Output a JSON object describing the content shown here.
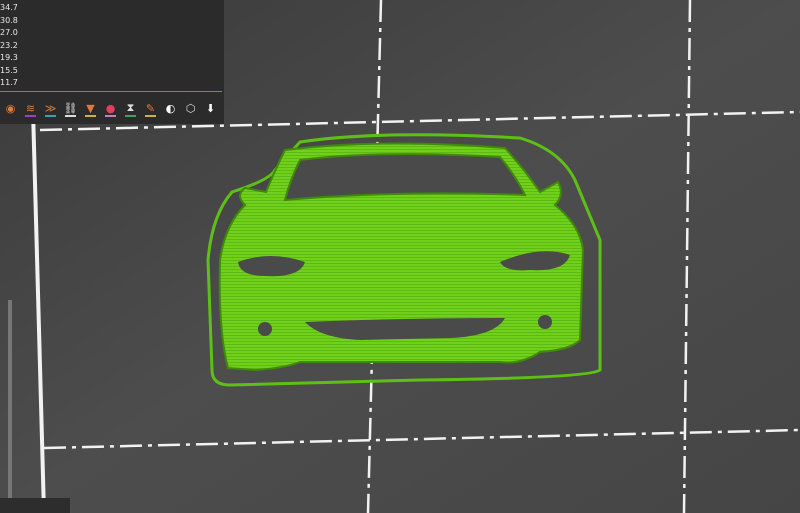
{
  "legend": {
    "values": [
      "34.7",
      "30.8",
      "27.0",
      "23.2",
      "19.3",
      "15.5",
      "11.7"
    ]
  },
  "toolbar": {
    "items": [
      {
        "name": "object-icon",
        "glyph": "◉",
        "color": "#e07a3a",
        "bar": ""
      },
      {
        "name": "layers-icon",
        "glyph": "≋",
        "color": "#d0813f",
        "bar": "#a040c0"
      },
      {
        "name": "infill-chevrons-icon",
        "glyph": "≫",
        "color": "#d0813f",
        "bar": "#3aa0b0"
      },
      {
        "name": "pattern-icon",
        "glyph": "⛓",
        "color": "#ddd",
        "bar": "#dddddd"
      },
      {
        "name": "extruder-icon",
        "glyph": "▼",
        "color": "#e07a3a",
        "bar": "#d0b040"
      },
      {
        "name": "color-icon",
        "glyph": "●",
        "color": "#e04060",
        "bar": "#c080c0"
      },
      {
        "name": "hourglass-icon",
        "glyph": "⧗",
        "color": "#ddd",
        "bar": "#40a060"
      },
      {
        "name": "paint-icon",
        "glyph": "✎",
        "color": "#e07a3a",
        "bar": "#d0b040"
      },
      {
        "name": "seam-icon",
        "glyph": "◐",
        "color": "#fff",
        "bar": ""
      },
      {
        "name": "cube-wireframe-icon",
        "glyph": "⬡",
        "color": "#ddd",
        "bar": ""
      },
      {
        "name": "download-icon",
        "glyph": "⬇",
        "color": "#fff",
        "bar": ""
      }
    ]
  },
  "colors": {
    "model": "#6fd11a",
    "model_dark": "#3f8a0a",
    "bed": "#4a4a4a"
  }
}
